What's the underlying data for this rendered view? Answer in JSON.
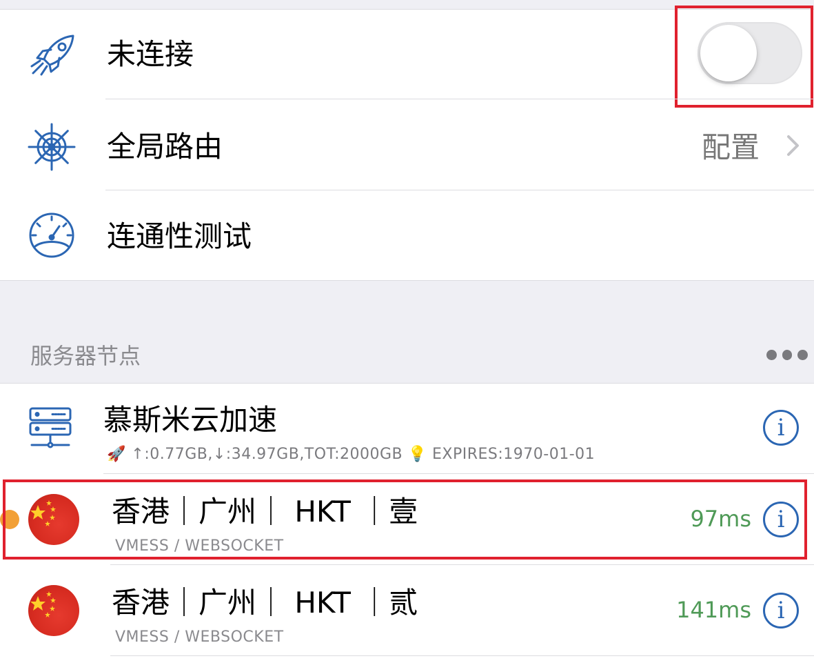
{
  "vpn": {
    "status_label": "未连接",
    "toggle_on": false
  },
  "routing": {
    "label": "全局路由",
    "detail": "配置"
  },
  "connectivity": {
    "label": "连通性测试"
  },
  "servers_section": {
    "header": "服务器节点"
  },
  "subscription": {
    "name": "慕斯米云加速",
    "stats": "🚀 ↑:0.77GB,↓:34.97GB,TOT:2000GB 💡 EXPIRES:1970-01-01"
  },
  "servers": [
    {
      "name": "香港｜广州｜ HKT ｜壹",
      "protocol": "VMESS / WEBSOCKET",
      "latency": "97ms",
      "selected": true
    },
    {
      "name": "香港｜广州｜ HKT ｜贰",
      "protocol": "VMESS / WEBSOCKET",
      "latency": "141ms",
      "selected": false
    }
  ],
  "colors": {
    "accent_blue": "#2b66b3",
    "latency_green": "#4f9a57",
    "highlight_red": "#e0212e",
    "selected_dot": "#f2a036"
  }
}
